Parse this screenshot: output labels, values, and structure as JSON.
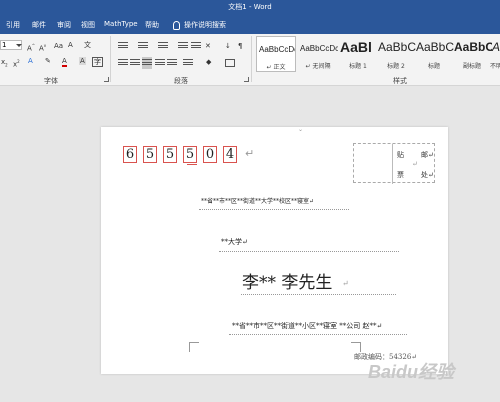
{
  "window": {
    "title": "文档1 - Word"
  },
  "menu": {
    "tabs": [
      "引用",
      "邮件",
      "审阅",
      "视图",
      "MathType",
      "帮助"
    ],
    "tell_me": "操作说明搜索"
  },
  "ribbon": {
    "font_size": "1",
    "groups": {
      "font": "字体",
      "paragraph": "段落",
      "styles": "样式"
    },
    "styles": [
      {
        "sample": "AaBbCcDc",
        "name": "↵ 正文"
      },
      {
        "sample": "AaBbCcDc",
        "name": "↵ 无间隔"
      },
      {
        "sample": "AaBl",
        "name": "标题 1"
      },
      {
        "sample": "AaBbC",
        "name": "标题 2"
      },
      {
        "sample": "AaBbC",
        "name": "标题"
      },
      {
        "sample": "AaBbC",
        "name": "副标题"
      },
      {
        "sample": "AaBbC",
        "name": "不明"
      }
    ]
  },
  "envelope": {
    "zip_digits": [
      "6",
      "5",
      "5",
      "5",
      "0",
      "4"
    ],
    "return_mark": "↵",
    "stamp": {
      "top_left": "贴",
      "top_right": "邮↵",
      "mid": "↵",
      "bottom_left": "票",
      "bottom_right": "处↵"
    },
    "recipient_address": "**省**市**区**街道**大学**校区**寝室↵",
    "recipient_org": "**大学↵",
    "recipient_name": "李** 李先生",
    "recipient_name_mark": "↵",
    "sender_address": "**省**市**区**街道**小区**寝室  **公司  赵**↵",
    "sender_postal": "邮政编码：54326↵"
  },
  "watermark": "Baidu经验"
}
